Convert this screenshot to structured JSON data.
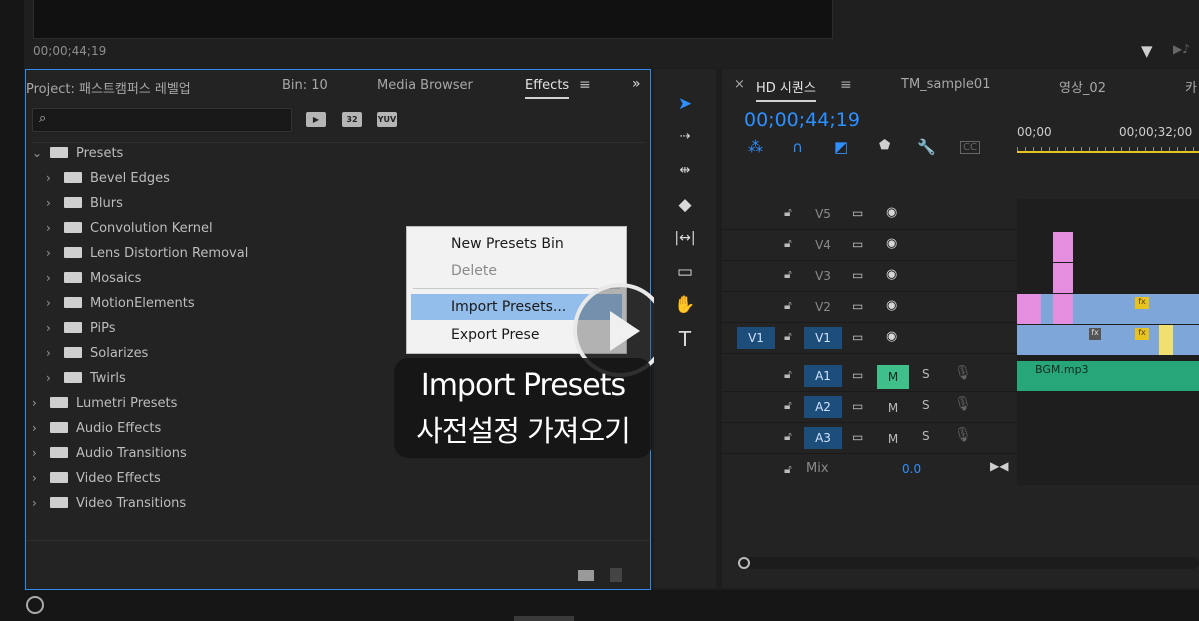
{
  "top": {
    "timecode": "00;00;44;19",
    "filter_icon": "filter-icon",
    "audio_icon": "audio-playback-icon"
  },
  "effects_panel": {
    "tabs": {
      "project": "Project: 패스트캠퍼스 레벨업",
      "bin": "Bin: 10",
      "media_browser": "Media Browser",
      "effects": "Effects",
      "menu_glyph": "≡",
      "more_glyph": "»"
    },
    "search": {
      "placeholder": "",
      "icon": "search-icon"
    },
    "filter_buttons": [
      "32",
      "YUV"
    ],
    "tree": [
      {
        "label": "Presets",
        "level": 0,
        "expanded": true
      },
      {
        "label": "Bevel Edges",
        "level": 1
      },
      {
        "label": "Blurs",
        "level": 1
      },
      {
        "label": "Convolution Kernel",
        "level": 1
      },
      {
        "label": "Lens Distortion Removal",
        "level": 1
      },
      {
        "label": "Mosaics",
        "level": 1
      },
      {
        "label": "MotionElements",
        "level": 1
      },
      {
        "label": "PiPs",
        "level": 1
      },
      {
        "label": "Solarizes",
        "level": 1
      },
      {
        "label": "Twirls",
        "level": 1
      },
      {
        "label": "Lumetri Presets",
        "level": 0
      },
      {
        "label": "Audio Effects",
        "level": 0
      },
      {
        "label": "Audio Transitions",
        "level": 0
      },
      {
        "label": "Video Effects",
        "level": 0
      },
      {
        "label": "Video Transitions",
        "level": 0
      }
    ]
  },
  "context_menu": {
    "new_presets_bin": "New Presets Bin",
    "delete": "Delete",
    "import_presets": "Import Presets...",
    "export_presets": "Export Prese"
  },
  "overlay": {
    "caption_en": "Import Presets",
    "caption_ko": "사전설정 가져오기",
    "play_icon": "play-icon"
  },
  "timeline": {
    "close_glyph": "×",
    "menu_glyph": "≡",
    "tabs": [
      "HD 시퀀스",
      "TM_sample01",
      "영상_02",
      "카"
    ],
    "timecode": "00;00;44;19",
    "ruler": [
      "00;00",
      "00;00;32;00"
    ],
    "video_tracks": [
      {
        "name": "V5",
        "on": false
      },
      {
        "name": "V4",
        "on": false
      },
      {
        "name": "V3",
        "on": false
      },
      {
        "name": "V2",
        "on": false
      },
      {
        "name": "V1",
        "on": true,
        "source": "V1"
      }
    ],
    "audio_tracks": [
      {
        "name": "A1",
        "m": "M",
        "s": "S",
        "m_on": true
      },
      {
        "name": "A2",
        "m": "M",
        "s": "S",
        "m_on": false
      },
      {
        "name": "A3",
        "m": "M",
        "s": "S",
        "m_on": false
      }
    ],
    "mix": {
      "label": "Mix",
      "value": "0.0"
    },
    "audio_clip": "BGM.mp3",
    "colors": {
      "accent": "#2e8fff",
      "video_clip": "#7fa6d9",
      "pink_clip": "#e58ee0",
      "audio_clip": "#27a67a",
      "playhead": "#e6c31f"
    }
  }
}
